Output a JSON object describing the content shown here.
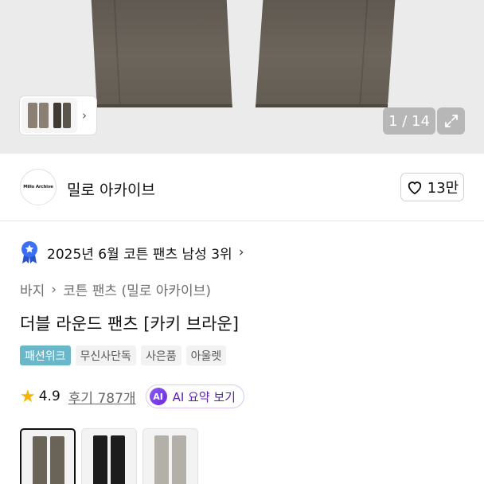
{
  "gallery": {
    "counter": "1 / 14",
    "thumb_icon": "chevron-right-icon",
    "expand_icon": "expand-icon"
  },
  "shop": {
    "logo_text": "Millo Archive",
    "name": "밀로 아카이브",
    "like_count": "13만",
    "like_icon": "heart-outline-icon"
  },
  "ranking": {
    "text": "2025년 6월 코튼 팬츠 남성 3위",
    "badge_color": "#3b6ff5"
  },
  "breadcrumb": {
    "items": [
      "바지",
      "코튼 팬츠 (밀로 아카이브)"
    ]
  },
  "product": {
    "title": "더블 라운드 팬츠 [카키 브라운]"
  },
  "tags": [
    "패션위크",
    "무신사단독",
    "사은품",
    "아울렛"
  ],
  "rating": {
    "score": "4.9",
    "reviews": "후기 787개",
    "star_color": "#f4b400"
  },
  "ai_summary": {
    "badge": "AI",
    "label": "AI 요약 보기"
  },
  "colors": {
    "khaki_brown": "#6a6458",
    "black": "#1c1c1c",
    "gray": "#b3b0aa",
    "tag_accent": "#6ab7c9"
  }
}
